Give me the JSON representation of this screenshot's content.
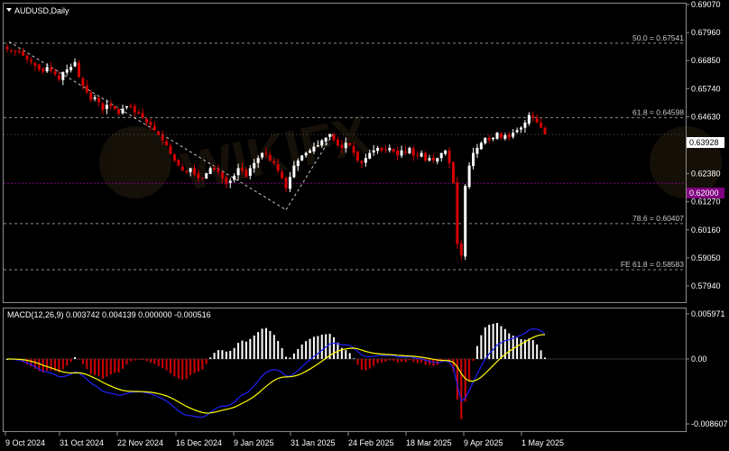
{
  "header": {
    "symbol_label": "AUDUSD,Daily"
  },
  "macd_header": "MACD(12,26,9) 0.003742 0.004139 0.000000 -0.000516",
  "colors": {
    "bull": "#ffffff",
    "bear": "#d40000",
    "grid": "#8c8c8c",
    "ma": "#ffff00",
    "signal": "#2020ff",
    "current_price_bg": "#ffffff",
    "support_bg": "#800080"
  },
  "price_axis": {
    "ticks": [
      "0.69070",
      "0.67960",
      "0.66850",
      "0.65740",
      "0.64630",
      "0.63520",
      "0.62380",
      "0.61270",
      "0.60160",
      "0.59050",
      "0.57940"
    ],
    "current_price": "0.63928",
    "support_level": "0.62000"
  },
  "macd_axis": {
    "ticks": [
      "0.005971",
      "0.00",
      "-0.008607"
    ]
  },
  "time_axis": {
    "labels": [
      "9 Oct 2024",
      "31 Oct 2024",
      "22 Nov 2024",
      "16 Dec 2024",
      "9 Jan 2025",
      "31 Jan 2025",
      "24 Feb 2025",
      "18 Mar 2025",
      "9 Apr 2025",
      "1 May 2025"
    ]
  },
  "levels": [
    {
      "text": "50.0 = 0.67541",
      "price": 0.67541
    },
    {
      "text": "61.8 = 0.64598",
      "price": 0.64598
    },
    {
      "text": "78.6 = 0.60407",
      "price": 0.60407
    },
    {
      "text": "FE 61.8 = 0.58583",
      "price": 0.58583
    }
  ],
  "chart_data": {
    "type": "candlestick",
    "symbol": "AUDUSD",
    "timeframe": "Daily",
    "ylim": [
      0.5794,
      0.6907
    ],
    "x_range": [
      "9 Oct 2024",
      "1 May 2025"
    ],
    "closes_sampled": [
      0.673,
      0.6725,
      0.6722,
      0.6718,
      0.6705,
      0.669,
      0.668,
      0.6665,
      0.665,
      0.6642,
      0.666,
      0.6645,
      0.663,
      0.661,
      0.664,
      0.665,
      0.666,
      0.668,
      0.662,
      0.6585,
      0.656,
      0.653,
      0.654,
      0.652,
      0.649,
      0.651,
      0.6505,
      0.6495,
      0.6475,
      0.6495,
      0.6505,
      0.65,
      0.648,
      0.6475,
      0.646,
      0.644,
      0.643,
      0.641,
      0.639,
      0.637,
      0.635,
      0.6315,
      0.629,
      0.627,
      0.625,
      0.6245,
      0.626,
      0.6235,
      0.622,
      0.6215,
      0.624,
      0.626,
      0.6255,
      0.6245,
      0.622,
      0.62,
      0.621,
      0.623,
      0.626,
      0.625,
      0.6225,
      0.626,
      0.628,
      0.63,
      0.632,
      0.6315,
      0.629,
      0.628,
      0.625,
      0.622,
      0.618,
      0.6225,
      0.627,
      0.629,
      0.631,
      0.632,
      0.633,
      0.6345,
      0.635,
      0.637,
      0.638,
      0.6395,
      0.637,
      0.635,
      0.634,
      0.636,
      0.635,
      0.632,
      0.629,
      0.628,
      0.63,
      0.632,
      0.633,
      0.634,
      0.633,
      0.633,
      0.634,
      0.6325,
      0.631,
      0.633,
      0.632,
      0.634,
      0.631,
      0.631,
      0.632,
      0.629,
      0.63,
      0.629,
      0.63,
      0.632,
      0.633,
      0.628,
      0.62,
      0.596,
      0.5915,
      0.619,
      0.627,
      0.632,
      0.634,
      0.636,
      0.638,
      0.637,
      0.638,
      0.64,
      0.638,
      0.639,
      0.638,
      0.64,
      0.641,
      0.642,
      0.644,
      0.647,
      0.646,
      0.644,
      0.642,
      0.6393
    ],
    "levels": [
      {
        "label": "50.0",
        "value": 0.67541
      },
      {
        "label": "61.8",
        "value": 0.64598
      },
      {
        "label": "78.6",
        "value": 0.60407
      },
      {
        "label": "FE 61.8",
        "value": 0.58583
      }
    ],
    "current_price": 0.63928,
    "support_level": 0.62,
    "macd": {
      "fast": 12,
      "slow": 26,
      "signal": 9,
      "main": 0.003742,
      "signal_value": 0.004139,
      "ylim": [
        -0.008607,
        0.005971
      ]
    }
  }
}
